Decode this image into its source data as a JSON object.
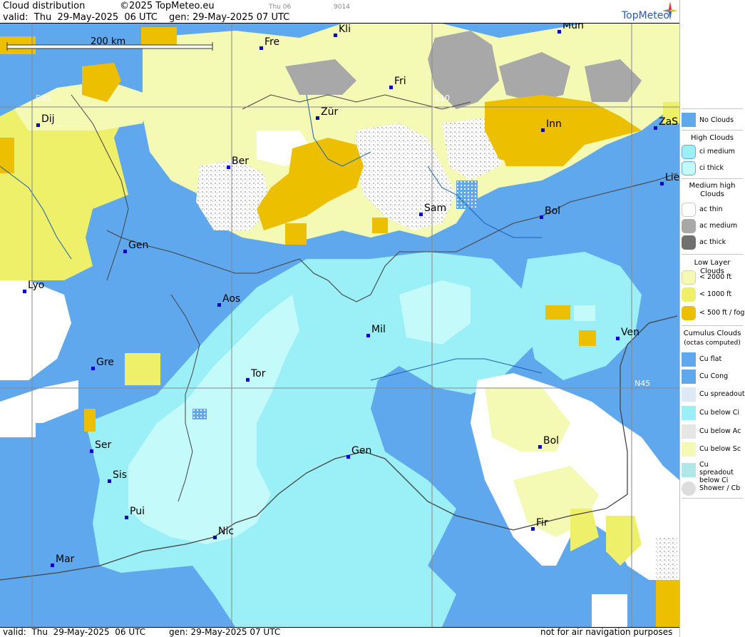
{
  "header": {
    "title": "Cloud distribution",
    "copyright": "©2025 TopMeteo.eu",
    "valid": "valid:  Thu  29-May-2025  06 UTC",
    "gen": "gen: 29-May-2025 07 UTC",
    "small_day": "Thu 06",
    "small_code": "9014",
    "logo": "TopMeteo"
  },
  "footer": {
    "valid": "valid:  Thu  29-May-2025  06 UTC",
    "gen": "gen: 29-May-2025 07 UTC",
    "disclaimer": "not for air navigation purposes"
  },
  "map": {
    "scale_label": "200 km",
    "grid_labels": [
      "E05",
      "E10",
      "N45"
    ],
    "cities": [
      "Kli",
      "Mun",
      "Fre",
      "Fri",
      "Dij",
      "Zür",
      "Inn",
      "ZaS",
      "Ber",
      "Lie",
      "Sam",
      "Bol",
      "Gen",
      "Lyo",
      "Aos",
      "Mil",
      "Ven",
      "Gre",
      "Tor",
      "Ser",
      "Gen",
      "Bol",
      "Sis",
      "Pui",
      "Nic",
      "Fir",
      "Mar"
    ]
  },
  "legend": {
    "no_clouds": "No Clouds",
    "high_title": "High Clouds",
    "ci_medium": "ci medium",
    "ci_thick": "ci thick",
    "medium_title": "Medium high Clouds",
    "ac_thin": "ac thin",
    "ac_medium": "ac medium",
    "ac_thick": "ac thick",
    "low_title": "Low Layer Clouds",
    "low_2000": "< 2000 ft",
    "low_1000": "< 1000 ft",
    "low_500": "< 500 ft / fog",
    "cu_title": "Cumulus Clouds",
    "cu_sub": "(octas computed)",
    "cu_flat": "Cu flat",
    "cu_cong": "Cu Cong",
    "cu_spreadout": "Cu spreadout",
    "cu_below_ci": "Cu below Ci",
    "cu_below_ac": "Cu below Ac",
    "cu_below_sc": "Cu below Sc",
    "cu_spreadout_below_ci": "Cu spreadout below Ci",
    "shower_cb": "Shower / Cb"
  },
  "colors": {
    "no_clouds": "#5fa8ee",
    "ci_medium": "#9af0f6",
    "ci_thick": "#c4fafa",
    "ac_thin": "#ffffff",
    "ac_medium": "#a8a8a8",
    "ac_thick": "#707070",
    "low_2000": "#f4fab4",
    "low_1000": "#eef06a",
    "low_500": "#ecc000"
  }
}
